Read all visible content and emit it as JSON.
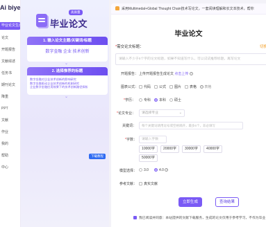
{
  "app": {
    "logo_text": "Ai biye"
  },
  "sidebar": {
    "items": [
      {
        "label": "毕业论文生成",
        "active": true
      },
      {
        "label": "论文"
      },
      {
        "label": "开题报告"
      },
      {
        "label": "文献综述"
      },
      {
        "label": "任务书"
      },
      {
        "label": "期刊论文"
      },
      {
        "label": "降重"
      },
      {
        "label": "PPT"
      },
      {
        "label": "文献"
      },
      {
        "label": "作业"
      },
      {
        "label": "我的"
      },
      {
        "label": "帮助"
      },
      {
        "label": "中心"
      }
    ]
  },
  "promo": {
    "badge": "高质量",
    "title": "毕业论文",
    "step1": {
      "head": "1. 输入论文主题/关键词/标题",
      "body": "数字金融 企业 技术创新"
    },
    "step2": {
      "head": "2. 选择推荐的标题",
      "lines": [
        "数字金融对企业技术创新的影响研究",
        "数字金融驱动企业技术创新的机制研究",
        "企业数字金融应用效果下的技术创新路径探析"
      ]
    },
    "tutorial": "下载教程"
  },
  "main": {
    "notice": "采用Multimedal+Global Thought Chain技术写论文，一套阅读理解和长文本技术，帮你",
    "form_title": "毕业论文",
    "title_field": {
      "label": "需交论文标题：",
      "help": "切换",
      "placeholder": "请输入不少于5个字的论文标题，如果不知道写什么，可以试试推荐标题，再写论文"
    },
    "report": {
      "label": "开题报告：",
      "text": "上传开题报告生成论文",
      "link": "点击上传"
    },
    "chart": {
      "label": "图表公式：",
      "options": [
        "代码",
        "公式",
        "图片",
        "表格"
      ],
      "tail": "表格"
    },
    "education": {
      "label": "学历：",
      "options": [
        "专科",
        "本科",
        "硕士"
      ],
      "selected": "本科"
    },
    "major": {
      "label": "论文专业：",
      "placeholder": "请选择专业"
    },
    "keywords": {
      "label": "关键词：",
      "placeholder": "每个关键词请用逗号或空格隔开，最多5个，非必填写"
    },
    "wordcount": {
      "label": "字数：",
      "placeholder": "请输入字数",
      "options": [
        "10000字",
        "20000字",
        "30000字",
        "40000字",
        "50000字"
      ]
    },
    "model": {
      "label": "模型选择：",
      "options": [
        "3.0",
        "4.0"
      ],
      "selected": "4.0"
    },
    "references": {
      "label": "参考文献：",
      "option": "真实文献"
    },
    "buttons": {
      "generate": "立即生成",
      "query": "查询结果"
    },
    "agree": "我已阅读并同意：本站提供的文献下载服务，生成的论文仅用于参考学习，不作为毕业"
  },
  "colors": {
    "accent": "#7a5af5",
    "notice_bell": "#f3a63b",
    "required": "#e33333"
  }
}
